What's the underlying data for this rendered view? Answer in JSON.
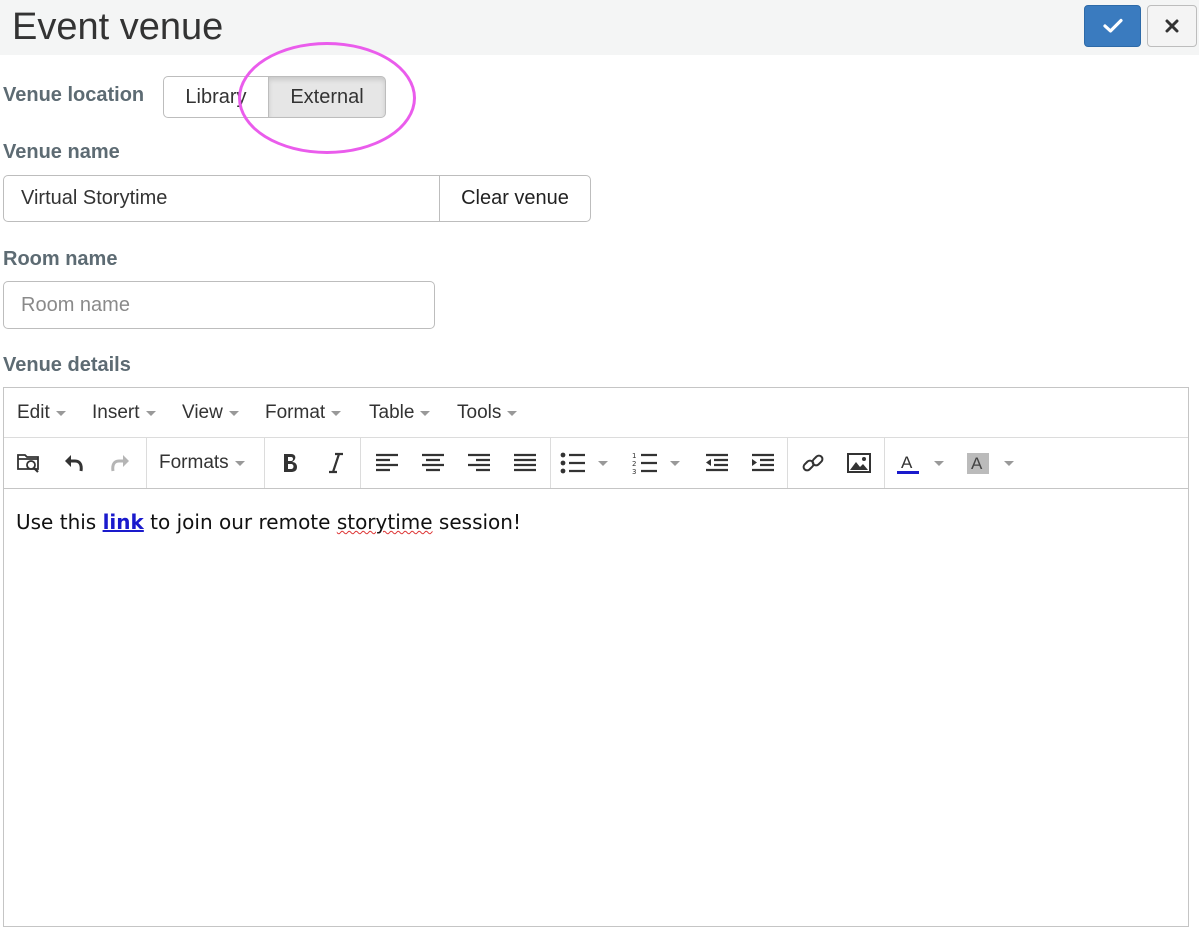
{
  "header": {
    "title": "Event venue",
    "save_icon": "check-icon",
    "close_icon": "close-icon"
  },
  "venue_location": {
    "label": "Venue location",
    "options": [
      "Library",
      "External"
    ],
    "selected": "External"
  },
  "venue_name": {
    "label": "Venue name",
    "value": "Virtual Storytime",
    "clear_label": "Clear venue"
  },
  "room_name": {
    "label": "Room name",
    "placeholder": "Room name",
    "value": ""
  },
  "venue_details": {
    "label": "Venue details",
    "menu": [
      "Edit",
      "Insert",
      "View",
      "Format",
      "Table",
      "Tools"
    ],
    "formats_label": "Formats",
    "content": {
      "before": "Use this ",
      "link": "link",
      "middle": " to join our remote ",
      "misspelled": "storytime",
      "after": " session!"
    }
  },
  "colors": {
    "accent": "#3a7bbf",
    "highlight": "#ea5cec",
    "label": "#5d6b73",
    "link": "#1a1acc"
  }
}
